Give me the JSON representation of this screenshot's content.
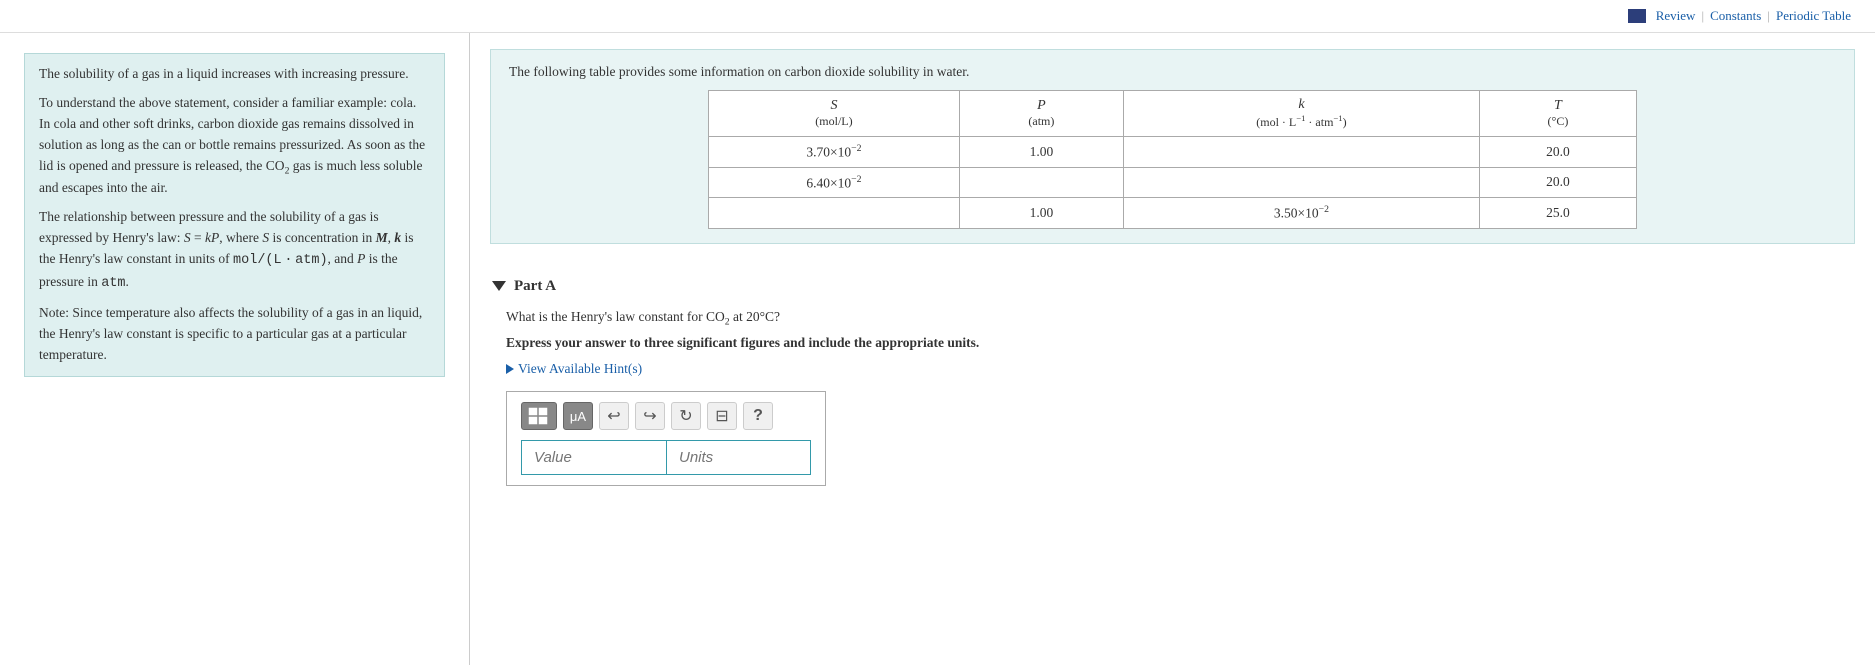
{
  "topbar": {
    "review_label": "Review",
    "constants_label": "Constants",
    "periodic_table_label": "Periodic Table",
    "separator": "|"
  },
  "left_panel": {
    "para1": "The solubility of a gas in a liquid increases with increasing pressure.",
    "para2": "To understand the above statement, consider a familiar example: cola. In cola and other soft drinks, carbon dioxide gas remains dissolved in solution as long as the can or bottle remains pressurized. As soon as the lid is opened and pressure is released, the CO₂ gas is much less soluble and escapes into the air.",
    "para3": "The relationship between pressure and the solubility of a gas is expressed by Henry's law: S = kP, where S is concentration in M, k is the Henry's law constant in units of mol/(L·atm), and P is the pressure in atm.",
    "para4": "Note: Since temperature also affects the solubility of a gas in an liquid, the Henry's law constant is specific to a particular gas at a particular temperature."
  },
  "info_box": {
    "intro": "The following table provides some information on carbon dioxide solubility in water.",
    "table": {
      "headers": [
        {
          "label": "S",
          "unit": "(mol/L)"
        },
        {
          "label": "P",
          "unit": "(atm)"
        },
        {
          "label": "k",
          "unit": "(mol · L⁻¹ · atm⁻¹)"
        },
        {
          "label": "T",
          "unit": "(°C)"
        }
      ],
      "rows": [
        {
          "S": "3.70×10⁻²",
          "P": "1.00",
          "k": "",
          "T": "20.0"
        },
        {
          "S": "6.40×10⁻²",
          "P": "",
          "k": "",
          "T": "20.0"
        },
        {
          "S": "",
          "P": "1.00",
          "k": "3.50×10⁻²",
          "T": "25.0"
        }
      ]
    }
  },
  "part_a": {
    "label": "Part A",
    "question": "What is the Henry's law constant for CO₂ at 20°C?",
    "instruction": "Express your answer to three significant figures and include the appropriate units.",
    "hint_label": "View Available Hint(s)",
    "toolbar": {
      "grid_icon": "⊞",
      "mu_icon": "μA",
      "undo_icon": "↩",
      "redo_icon": "↪",
      "refresh_icon": "↺",
      "keyboard_icon": "⌨",
      "help_icon": "?"
    },
    "value_placeholder": "Value",
    "units_placeholder": "Units"
  }
}
